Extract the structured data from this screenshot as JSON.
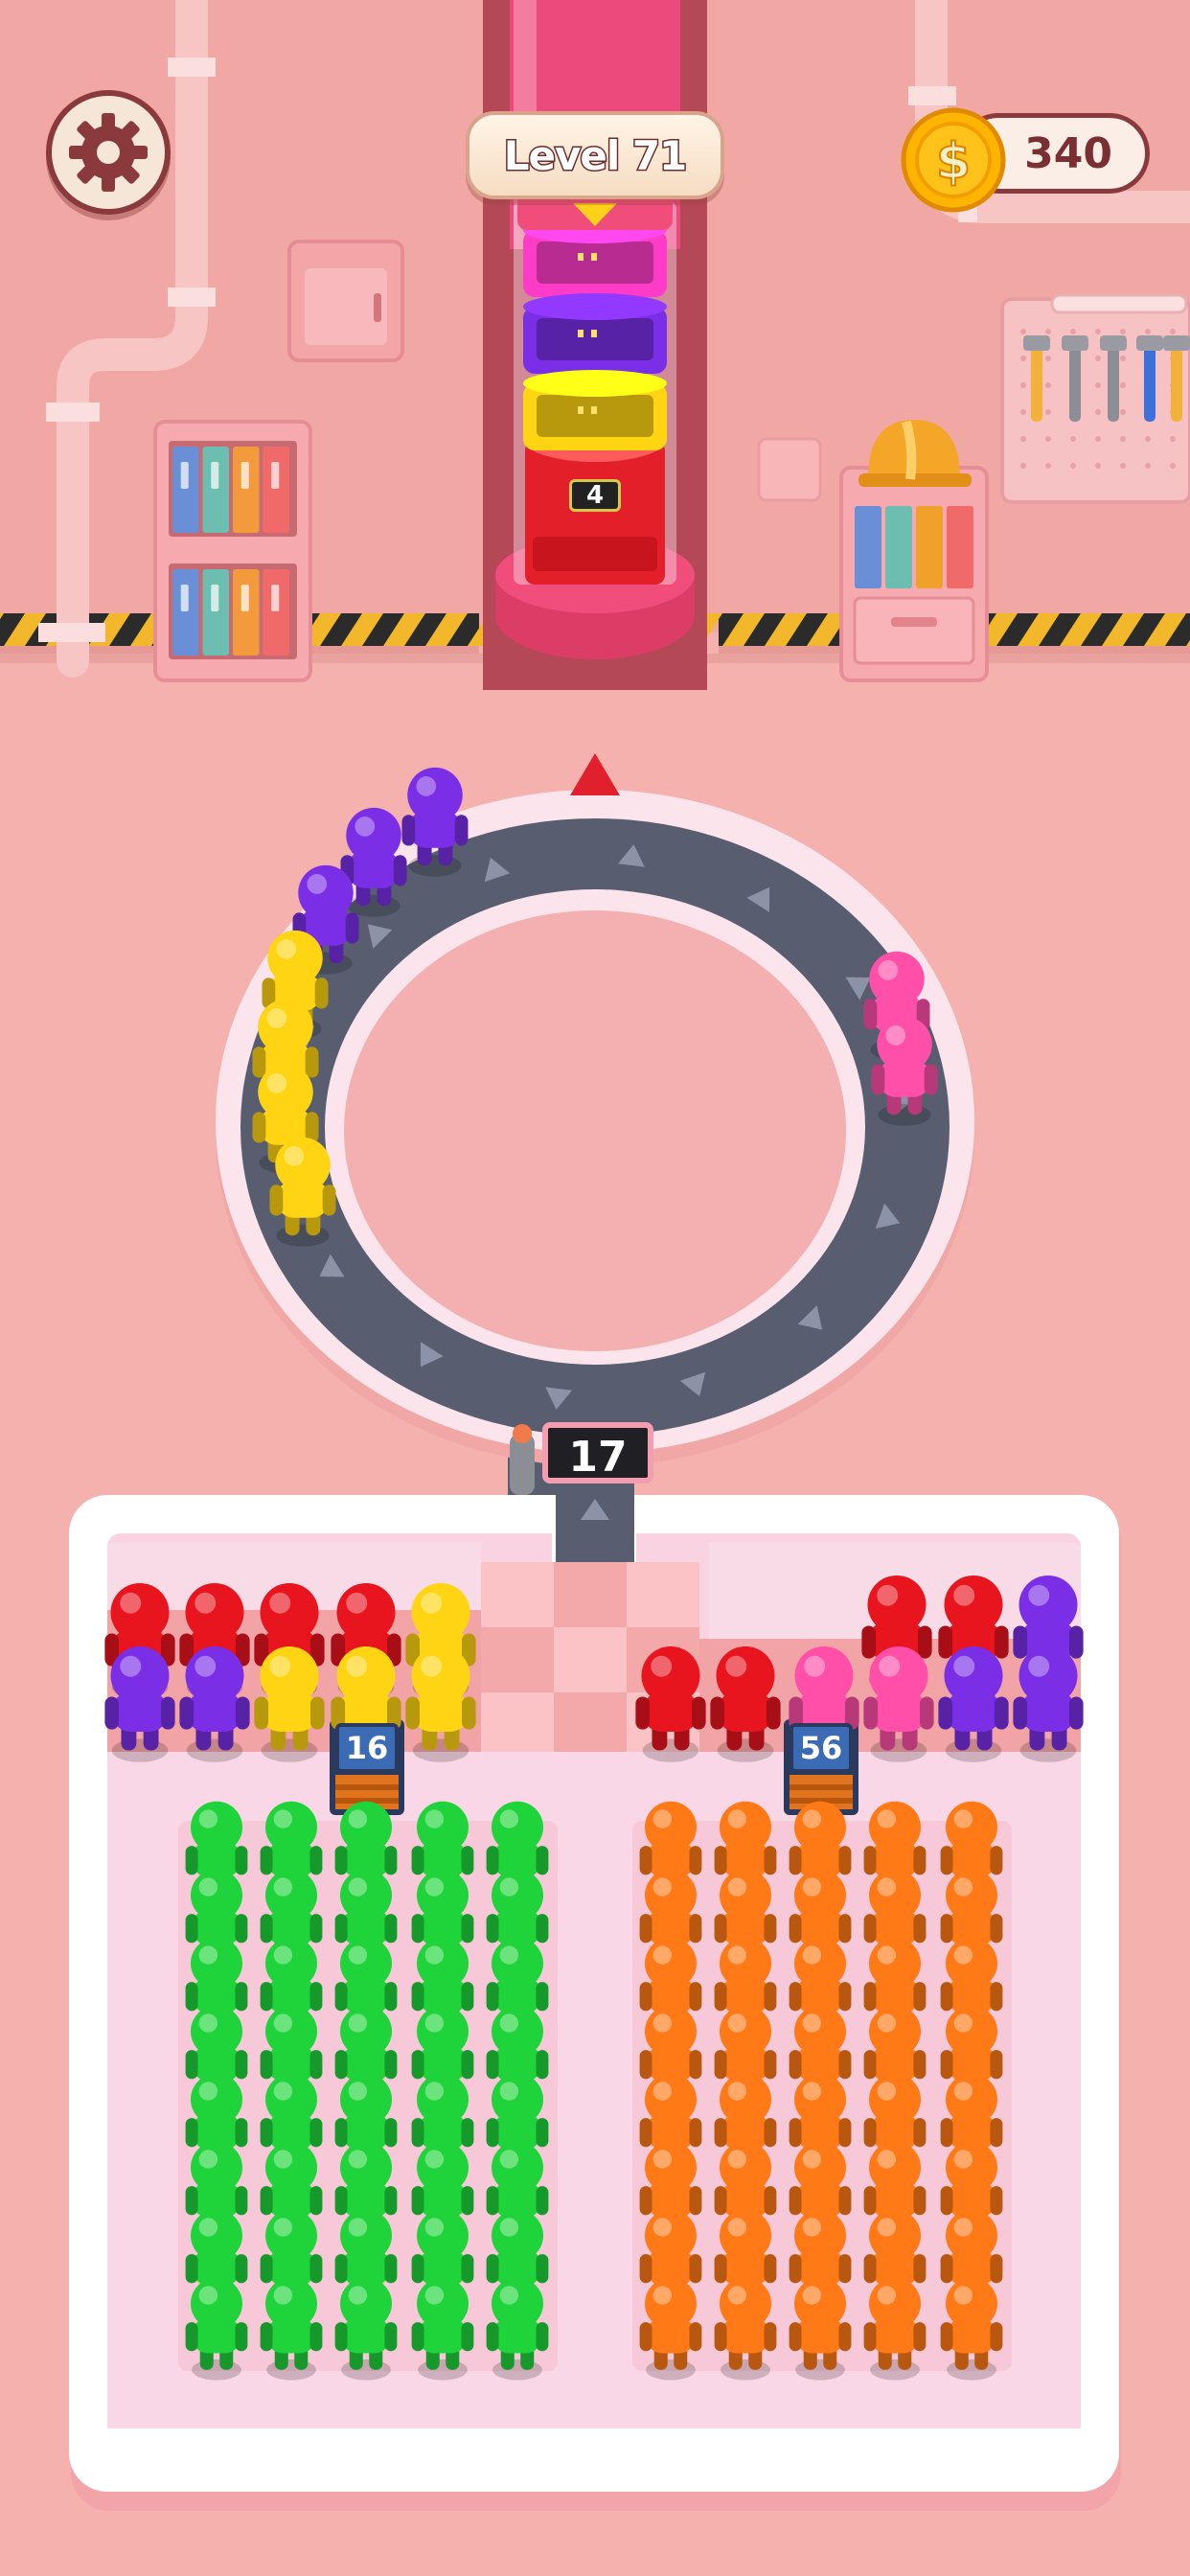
{
  "hud": {
    "level_label": "Level 71",
    "coins": "340"
  },
  "icons": {
    "settings": "gear-icon",
    "coin": "dollar-coin-icon",
    "exit_arrow": "triangle-up-icon"
  },
  "lift": {
    "remaining_label": "4",
    "stack": [
      "magenta",
      "purple",
      "yellow"
    ]
  },
  "ring": {
    "capacity_label": "17",
    "riders": [
      "purple",
      "purple",
      "purple",
      "yellow",
      "yellow",
      "yellow",
      "yellow",
      "pink",
      "pink"
    ]
  },
  "gates": [
    {
      "label": "16",
      "front_row": [
        "purple",
        "purple",
        "yellow",
        "yellow",
        "yellow"
      ],
      "back_row": [
        "red",
        "red",
        "red",
        "red",
        "yellow"
      ]
    },
    {
      "label": "56",
      "front_row": [
        "red",
        "red",
        "pink",
        "pink",
        "purple",
        "purple"
      ],
      "back_row": [
        "red",
        "red",
        "purple"
      ]
    }
  ],
  "crowds": [
    {
      "color": "green",
      "columns": 5,
      "rows": 8
    },
    {
      "color": "orange",
      "columns": 5,
      "rows": 8
    }
  ],
  "colors": {
    "background": "#f4b1ad",
    "wall": "#f1a8a4",
    "floor": "#f4b1ad",
    "track": "#585e70",
    "red": "#e8141e",
    "purple": "#7a2fe6",
    "yellow": "#ffd513",
    "pink": "#ff4fa8",
    "green": "#1fd43a",
    "orange": "#ff7a16",
    "magenta": "#ff3cc8",
    "coin": "#ffb400"
  }
}
